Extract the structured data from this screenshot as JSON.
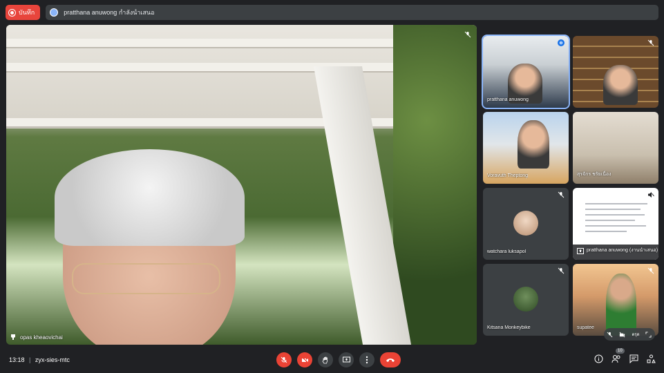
{
  "top": {
    "record_label": "บันทึก",
    "presenting_text": "pratthana anuwong กำลังนำเสนอ"
  },
  "main": {
    "speaker_name": "opas kheaovichai"
  },
  "tiles": [
    {
      "name": "pratthana anuwong"
    },
    {
      "name": ""
    },
    {
      "name": "Voravuth Theptong"
    },
    {
      "name": "สุรจักร ชรัยเนื่อง"
    },
    {
      "name": "watchara luksapol"
    },
    {
      "name": "pratthana anuwong (งานนำเสนอ)"
    },
    {
      "name": "Kitsana Monkeybike"
    },
    {
      "name": "supatee"
    }
  ],
  "tile_controls": {
    "pin_label": "ตรุด"
  },
  "bottom": {
    "time": "13:18",
    "meeting_code": "zyx-sies-mtc",
    "participant_count": "10"
  },
  "colors": {
    "background": "#202124",
    "active_outline": "#8ab4f8",
    "danger": "#ea4335"
  }
}
